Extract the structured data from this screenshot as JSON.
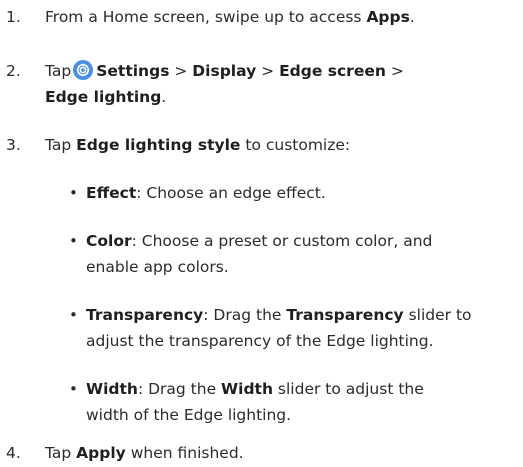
{
  "steps": [
    {
      "number": "1.",
      "text_before": "From a Home screen, swipe up to access ",
      "bold": "Apps",
      "text_after": "."
    },
    {
      "number": "2.",
      "tap": "Tap",
      "settings": "Settings",
      "sep1": ">",
      "display": "Display",
      "sep2": ">",
      "edge_screen": "Edge screen",
      "sep3": ">",
      "edge_lighting": "Edge lighting",
      "end": "."
    },
    {
      "number": "3.",
      "tap": "Tap ",
      "bold": "Edge lighting style",
      "text_after": " to customize:"
    },
    {
      "number": "4.",
      "tap": "Tap ",
      "bold": "Apply",
      "text_after": " when finished."
    }
  ],
  "bullets": [
    {
      "marker": "•",
      "term": "Effect",
      "text": ": Choose an edge effect."
    },
    {
      "marker": "•",
      "term": "Color",
      "text_line1": ": Choose a preset or custom color, and",
      "text_line2": "enable app colors."
    },
    {
      "marker": "•",
      "term": "Transparency",
      "text_a": ": Drag the ",
      "term2": "Transparency",
      "text_b": " slider to",
      "text_line2": "adjust the transparency of the Edge lighting."
    },
    {
      "marker": "•",
      "term": "Width",
      "text_a": ": Drag the ",
      "term2": "Width",
      "text_b": " slider to adjust the",
      "text_line2": "width of the Edge lighting."
    }
  ],
  "icons": {
    "settings": "settings-gear-icon",
    "settings_color": "#4a8fe3"
  }
}
